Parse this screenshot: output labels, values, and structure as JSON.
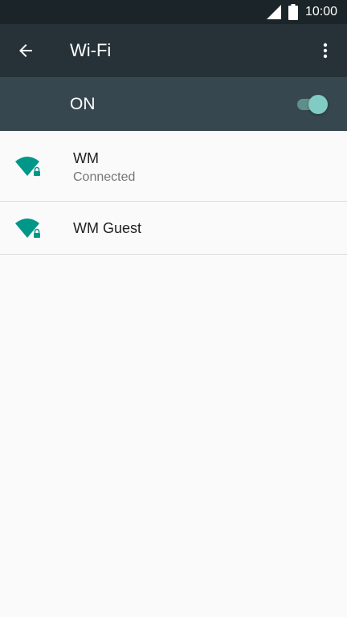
{
  "status_bar": {
    "time": "10:00",
    "icons": [
      "signal-icon",
      "battery-icon"
    ]
  },
  "app_bar": {
    "title": "Wi-Fi",
    "back_icon": "arrow-back-icon",
    "menu_icon": "more-vert-icon"
  },
  "master_switch": {
    "label": "ON",
    "enabled": true
  },
  "networks": [
    {
      "ssid": "WM",
      "status": "Connected",
      "icon": "wifi-lock-icon"
    },
    {
      "ssid": "WM Guest",
      "icon": "wifi-lock-icon"
    }
  ],
  "colors": {
    "status_bar": "#1b2429",
    "app_bar": "#263238",
    "switch_bar": "#37474f",
    "accent": "#009688",
    "toggle_thumb": "#80cbc4",
    "background": "#fafafa"
  }
}
